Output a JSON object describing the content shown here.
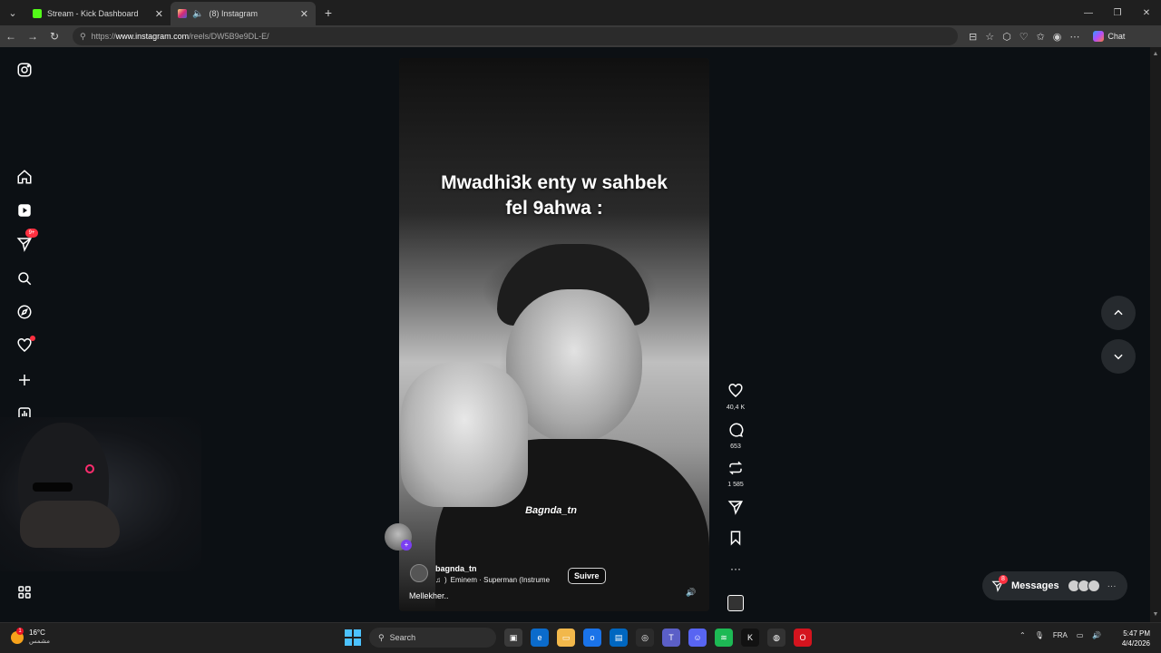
{
  "browser": {
    "tabs": [
      {
        "title": "Stream - Kick Dashboard",
        "favicon_color": "#53fc18",
        "active": false
      },
      {
        "title": "(8) Instagram",
        "favicon_color": "#e1306c",
        "active": true
      }
    ],
    "url_prefix": "https://",
    "url_host": "www.instagram.com",
    "url_path": "/reels/DW5B9e9DL-E/",
    "chat_label": "Chat"
  },
  "sidebar": {
    "notifications_badge": "9+"
  },
  "reel": {
    "overlay_text_line1": "Mwadhi3k enty w sahbek",
    "overlay_text_line2": "fel 9ahwa :",
    "watermark": "Bagnda_tn",
    "username": "bagnda_tn",
    "audio": "Eminem · Superman (Instrume",
    "follow_label": "Suivre",
    "caption": "Mellekher.."
  },
  "actions": {
    "likes": "40,4 K",
    "comments": "653",
    "reposts": "1 585"
  },
  "messages": {
    "label": "Messages",
    "badge": "8"
  },
  "taskbar": {
    "weather_temp": "16°C",
    "weather_desc": "مشمس",
    "weather_badge": "1",
    "search_placeholder": "Search",
    "language": "FRA",
    "time": "5:47 PM",
    "date": "4/4/2026"
  }
}
